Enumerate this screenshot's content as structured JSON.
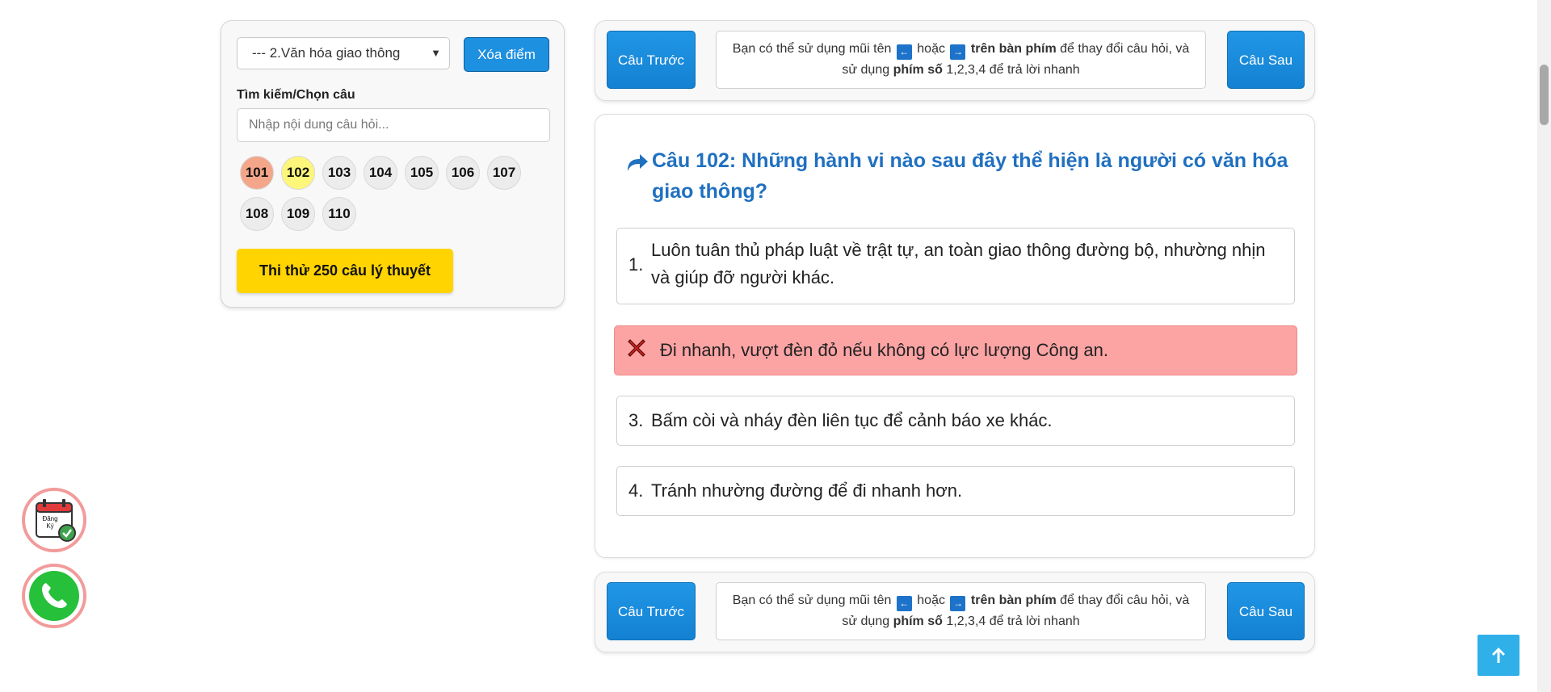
{
  "sidebar": {
    "category_select": "--- 2.Văn hóa giao thông",
    "clear_button": "Xóa điểm",
    "search_label": "Tìm kiếm/Chọn câu",
    "search_placeholder": "Nhập nội dung câu hỏi...",
    "question_numbers": [
      {
        "label": "101",
        "state": "wrong"
      },
      {
        "label": "102",
        "state": "current"
      },
      {
        "label": "103",
        "state": "none"
      },
      {
        "label": "104",
        "state": "none"
      },
      {
        "label": "105",
        "state": "none"
      },
      {
        "label": "106",
        "state": "none"
      },
      {
        "label": "107",
        "state": "none"
      },
      {
        "label": "108",
        "state": "none"
      },
      {
        "label": "109",
        "state": "none"
      },
      {
        "label": "110",
        "state": "none"
      }
    ],
    "exam_button": "Thi thử 250 câu lý thuyết"
  },
  "nav": {
    "prev_label": "Câu Trước",
    "next_label": "Câu Sau",
    "hint_part1": "Bạn có thể sử dụng mũi tên",
    "hint_or": "hoặc",
    "hint_keyboard": "trên bàn phím",
    "hint_part2": "để thay đổi câu hỏi, và",
    "hint_part3": "sử dụng",
    "hint_number_keys": "phím số",
    "hint_part4": "1,2,3,4 để trả lời nhanh",
    "left_arrow": "←",
    "right_arrow": "→"
  },
  "question": {
    "title": "Câu 102: Những hành vi nào sau đây thể hiện là người có văn hóa giao thông?",
    "answers": [
      {
        "num": "1.",
        "text": "Luôn tuân thủ pháp luật về trật tự, an toàn giao thông đường bộ, nhường nhịn và giúp đỡ người khác.",
        "state": "normal"
      },
      {
        "num": "",
        "text": "Đi nhanh, vượt đèn đỏ nếu không có lực lượng Công an.",
        "state": "wrong"
      },
      {
        "num": "3.",
        "text": "Bấm còi và nháy đèn liên tục để cảnh báo xe khác.",
        "state": "normal"
      },
      {
        "num": "4.",
        "text": "Tránh nhường đường để đi nhanh hơn.",
        "state": "normal"
      }
    ]
  },
  "floating": {
    "register_label_line1": "Đăng",
    "register_label_line2": "Ký"
  },
  "colors": {
    "accent_blue": "#1e90e0",
    "title_blue": "#2070c0",
    "wrong_red": "#fca3a4",
    "current_yellow": "#fdf67a",
    "exam_yellow": "#ffd400"
  }
}
